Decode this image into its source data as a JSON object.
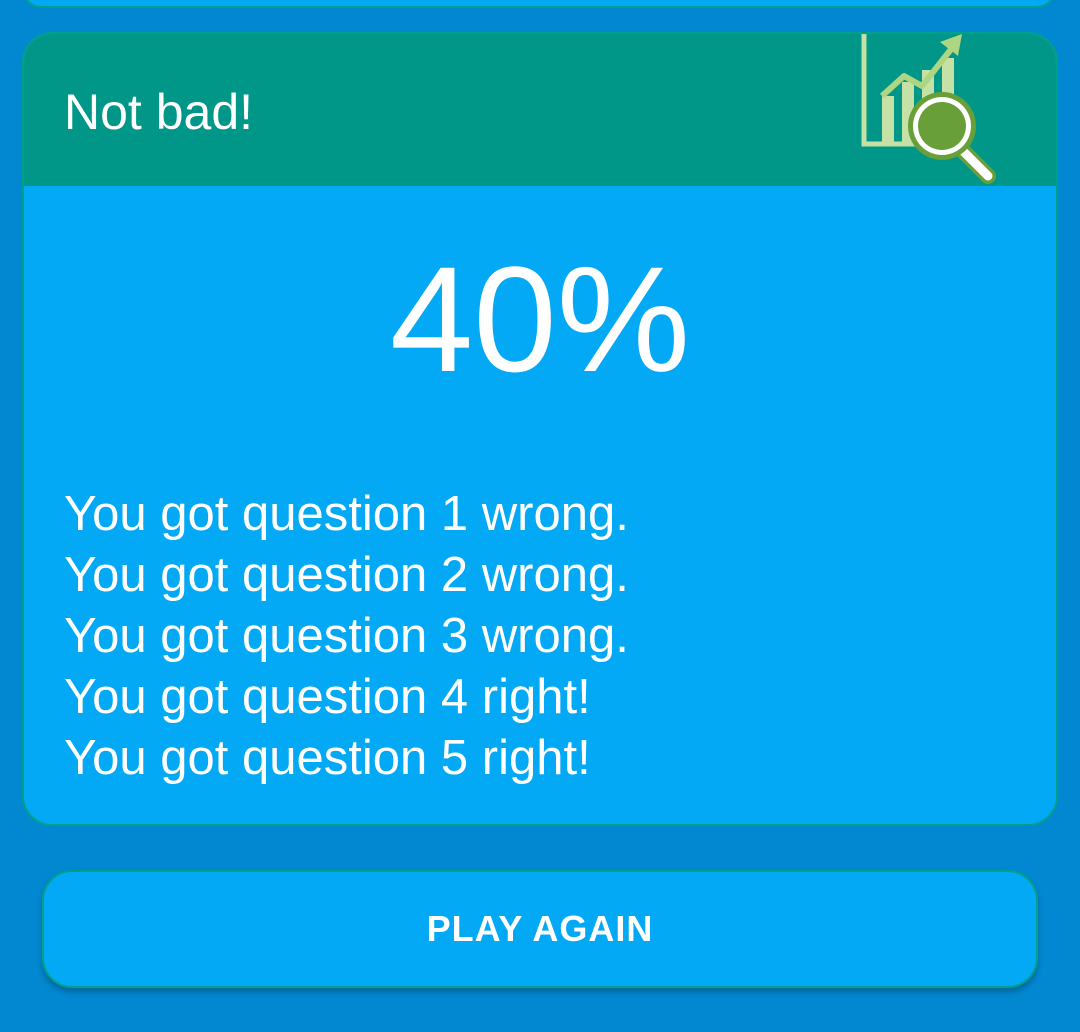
{
  "result": {
    "title": "Not bad!",
    "icon": "chart-magnifier-icon",
    "score": "40%",
    "answers": [
      "You got question 1 wrong.",
      "You got question 2 wrong.",
      "You got question 3 wrong.",
      "You got question 4 right!",
      "You got question 5 right!"
    ]
  },
  "actions": {
    "play_again_label": "PLAY AGAIN"
  },
  "colors": {
    "background": "#0288d1",
    "card": "#03a9f4",
    "header": "#009688",
    "border": "#00a08a",
    "icon_green": "#689f38",
    "icon_light_green": "#aed581"
  }
}
